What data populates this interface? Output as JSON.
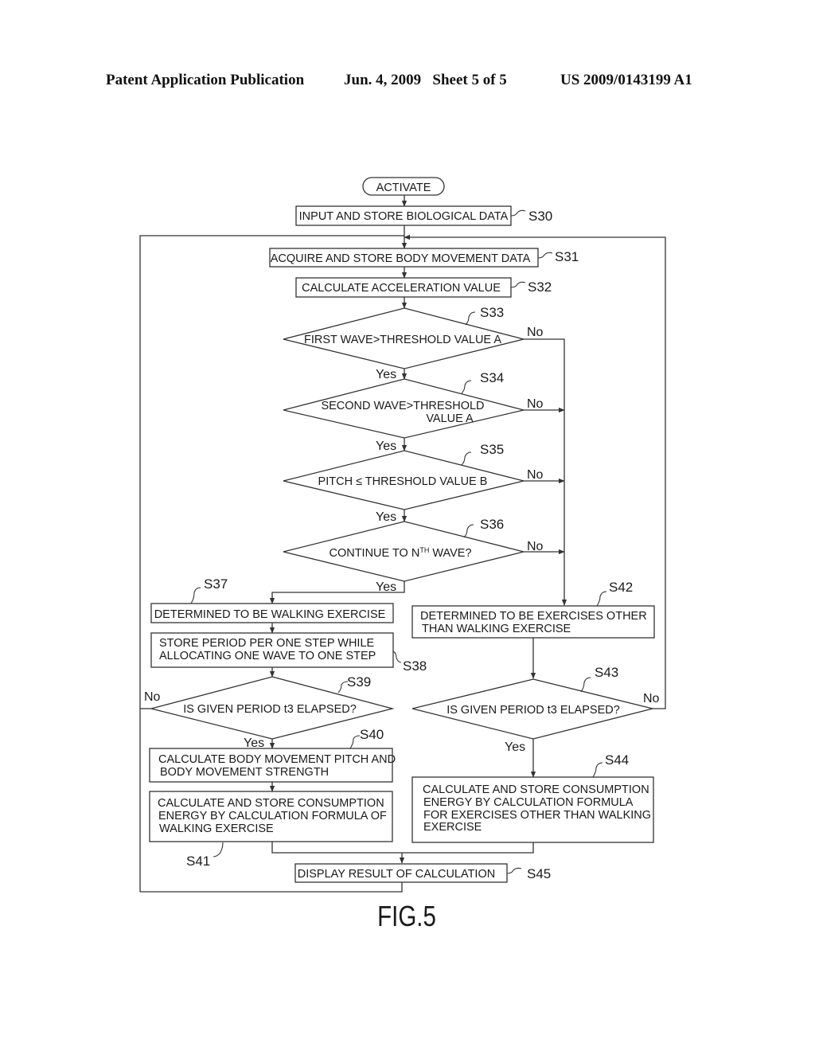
{
  "header": {
    "publication": "Patent Application Publication",
    "date_sheet": "Jun. 4, 2009   Sheet 5 of 5",
    "number": "US 2009/0143199 A1"
  },
  "figure_label": "FIG.5",
  "flowchart": {
    "start": "ACTIVATE",
    "steps": {
      "S30": {
        "id": "S30",
        "lines": [
          "INPUT AND STORE BIOLOGICAL DATA"
        ]
      },
      "S31": {
        "id": "S31",
        "lines": [
          "ACQUIRE AND STORE BODY MOVEMENT DATA"
        ]
      },
      "S32": {
        "id": "S32",
        "lines": [
          "CALCULATE ACCELERATION VALUE"
        ]
      },
      "S33": {
        "id": "S33",
        "lines": [
          "FIRST WAVE>THRESHOLD VALUE A"
        ]
      },
      "S34": {
        "id": "S34",
        "lines": [
          "SECOND WAVE>THRESHOLD",
          "VALUE A"
        ]
      },
      "S35": {
        "id": "S35",
        "lines": [
          "PITCH ≤ THRESHOLD VALUE B"
        ]
      },
      "S36": {
        "id": "S36",
        "lines": [
          "CONTINUE TO N",
          "TH",
          " WAVE?"
        ]
      },
      "S37": {
        "id": "S37",
        "lines": [
          "DETERMINED TO BE WALKING EXERCISE"
        ]
      },
      "S38": {
        "id": "S38",
        "lines": [
          "STORE PERIOD PER ONE STEP WHILE",
          "ALLOCATING ONE WAVE TO ONE STEP"
        ]
      },
      "S39": {
        "id": "S39",
        "lines": [
          "IS GIVEN PERIOD t3 ELAPSED?"
        ]
      },
      "S40": {
        "id": "S40",
        "lines": [
          "CALCULATE BODY MOVEMENT PITCH AND",
          "BODY MOVEMENT STRENGTH"
        ]
      },
      "S41": {
        "id": "S41",
        "lines": [
          "CALCULATE AND STORE CONSUMPTION",
          "ENERGY BY CALCULATION FORMULA OF",
          "WALKING EXERCISE"
        ]
      },
      "S42": {
        "id": "S42",
        "lines": [
          "DETERMINED TO BE EXERCISES OTHER",
          "THAN WALKING EXERCISE"
        ]
      },
      "S43": {
        "id": "S43",
        "lines": [
          "IS GIVEN PERIOD t3 ELAPSED?"
        ]
      },
      "S44": {
        "id": "S44",
        "lines": [
          "CALCULATE AND STORE CONSUMPTION",
          "ENERGY BY CALCULATION FORMULA",
          "FOR EXERCISES OTHER THAN WALKING",
          "EXERCISE"
        ]
      },
      "S45": {
        "id": "S45",
        "lines": [
          "DISPLAY RESULT OF CALCULATION"
        ]
      }
    },
    "branch_labels": {
      "yes": "Yes",
      "no": "No"
    }
  }
}
